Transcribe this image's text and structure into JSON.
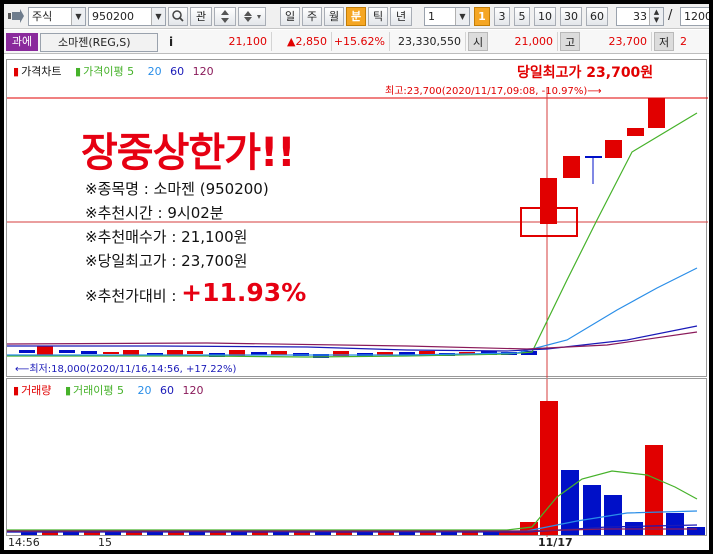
{
  "toolbar": {
    "market_type": "주식",
    "stock_code": "950200",
    "watch_label": "관",
    "periods": [
      "일",
      "주",
      "월",
      "분",
      "틱",
      "년"
    ],
    "active_period": "분",
    "interval_value": "1",
    "interval_numbers": [
      "1",
      "3",
      "5",
      "10",
      "30",
      "60"
    ],
    "active_interval": "1",
    "count_value": "33",
    "slash": "/",
    "count_total": "1200"
  },
  "quote": {
    "market_badge": "과에",
    "stock_name": "소마젠(REG,S)",
    "info_icon_label": "i",
    "price": "21,100",
    "change": "▲2,850",
    "change_pct": "+15.62%",
    "volume": "23,330,550",
    "open_label": "시",
    "open": "21,000",
    "high_label": "고",
    "high": "23,700",
    "low_label": "저",
    "low": "2"
  },
  "colors": {
    "up": "#e10000",
    "down": "#0010c8",
    "ma5": "#46b22a",
    "ma20": "#2a8ee8",
    "ma60": "#1a1ab8",
    "ma120": "#8a1a5a"
  },
  "price_panel": {
    "legend": [
      "가격차트",
      "가격이평 5",
      "20",
      "60",
      "120"
    ],
    "high_note": "당일최고가 23,700원",
    "high_detail": "최고:23,700(2020/11/17,09:08, -10.97%)⟶",
    "low_detail": "⟵최저:18,000(2020/11/16,14:56, +17.22%)"
  },
  "callout": {
    "headline": "장중상한가!!",
    "line1": "※종목명 : 소마젠 (950200)",
    "line2": "※추천시간 : 9시02분",
    "line3": "※추천매수가 : 21,100원",
    "line4": "※당일최고가 : 23,700원",
    "line5_label": "※추천가대비 : ",
    "line5_value": "+11.93%"
  },
  "volume_panel": {
    "legend": [
      "거래량",
      "거래이평 5",
      "20",
      "60",
      "120"
    ]
  },
  "x_axis": {
    "labels": [
      "14:56",
      "15",
      "11/17"
    ]
  }
}
